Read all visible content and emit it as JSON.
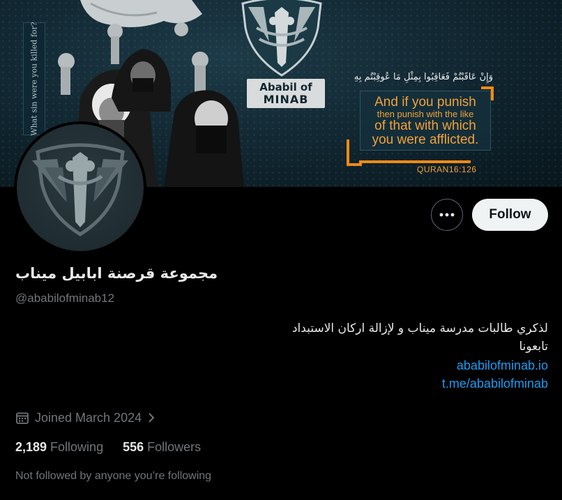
{
  "banner": {
    "side_caption": "What sin were you killed for?",
    "brand_line1": "Ababil of",
    "brand_line2": "MINAB",
    "verse_arabic": "وَإِنْ عَاقَبْتُمْ فَعَاقِبُوا بِمِثْلِ مَا عُوقِبْتُم بِهِ",
    "verse_line1": "And if you punish",
    "verse_line2": "then punish with the like",
    "verse_line3": "of that with which",
    "verse_line4": "you were afflicted.",
    "verse_ref": "QURAN16:126"
  },
  "profile": {
    "display_name": "مجموعة قرصنة ابابيل ميناب",
    "handle": "@ababilofminab12",
    "bio_line1": "لذكري طالبات مدرسة ميناب و لإزالة اركان الاستبداد",
    "bio_line2": "تابعونا",
    "link1": "ababilofminab.io",
    "link2": "t.me/ababilofminab",
    "joined": "Joined March 2024",
    "following_count": "2,189",
    "following_label": "Following",
    "followers_count": "556",
    "followers_label": "Followers",
    "not_followed": "Not followed by anyone you’re following"
  },
  "actions": {
    "follow_label": "Follow",
    "more_icon": "more-horizontal-icon"
  },
  "colors": {
    "background": "#000000",
    "accent_link": "#1d9bf0",
    "secondary_text": "#71767b",
    "verse_orange": "#f4a13a"
  }
}
